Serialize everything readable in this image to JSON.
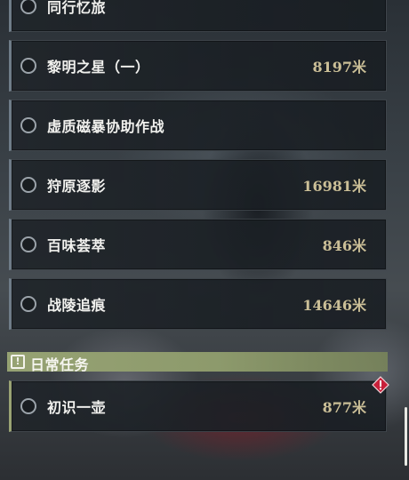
{
  "quests": [
    {
      "name": "同行忆旅",
      "distance": ""
    },
    {
      "name": "黎明之星（一）",
      "distance": "8197米"
    },
    {
      "name": "虚质磁暴协助作战",
      "distance": ""
    },
    {
      "name": "狩原逐影",
      "distance": "16981米"
    },
    {
      "name": "百味荟萃",
      "distance": "846米"
    },
    {
      "name": "战陵追痕",
      "distance": "14646米"
    }
  ],
  "daily_section": {
    "title": "日常任务",
    "icon": "exclamation-icon"
  },
  "daily_quests": [
    {
      "name": "初识一壶",
      "distance": "877米"
    }
  ],
  "colors": {
    "distance_text": "#cbbf97",
    "section_bar": "#96a273",
    "warning_badge": "#c8203a"
  }
}
